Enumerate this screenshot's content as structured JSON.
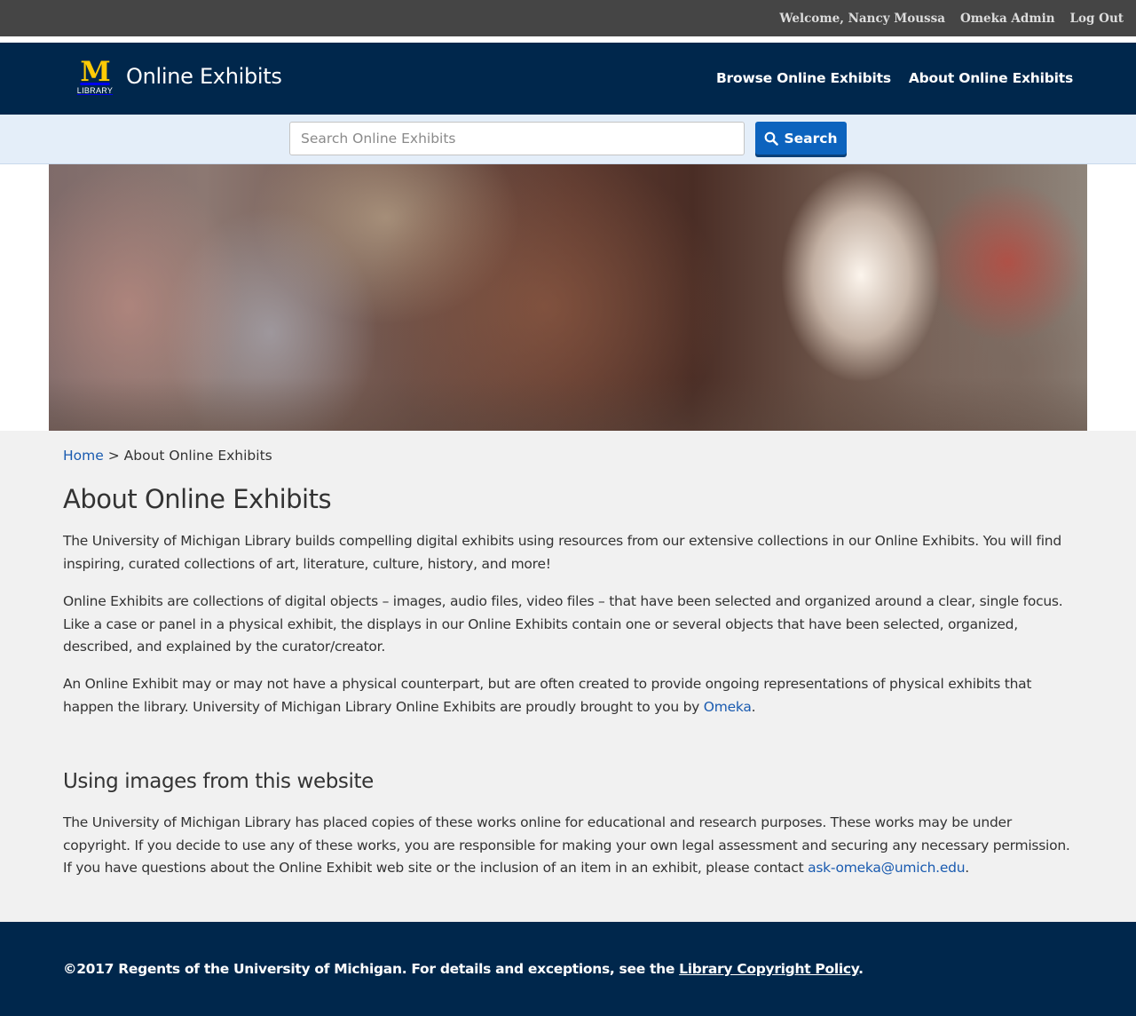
{
  "admin_bar": {
    "welcome": "Welcome, Nancy Moussa",
    "admin_link": "Omeka Admin",
    "logout_link": "Log Out"
  },
  "header": {
    "logo_letter": "M",
    "logo_subtext": "LIBRARY",
    "site_title": "Online Exhibits",
    "nav": [
      "Browse Online Exhibits",
      "About Online Exhibits"
    ]
  },
  "search": {
    "placeholder": "Search Online Exhibits",
    "button_label": "Search"
  },
  "breadcrumb": {
    "home": "Home",
    "separator": ">",
    "current": "About Online Exhibits"
  },
  "main": {
    "title": "About Online Exhibits",
    "paragraph_1": "The University of Michigan Library builds compelling digital exhibits using resources from our extensive collections in our Online Exhibits. You will find inspiring, curated collections of art, literature, culture, history, and more!",
    "paragraph_2": "Online Exhibits are collections of digital objects – images, audio files, video files – that have been selected and organized around a clear, single focus. Like a case or panel in a physical exhibit, the displays in our Online Exhibits contain one or several objects that have been selected, organized, described, and explained by the curator/creator.",
    "paragraph_3_text": "An Online Exhibit may or may not have a physical counterpart, but are often created to provide ongoing representations of physical exhibits that happen the library. University of Michigan Library Online Exhibits are proudly brought to you by",
    "paragraph_3_link": "Omeka",
    "paragraph_3_end": ".",
    "section_title": "Using images from this website",
    "section_text": "The University of Michigan Library has placed copies of these works online for educational and research purposes. These works may be under copyright. If you decide to use any of these works, you are responsible for making your own legal assessment and securing any necessary permission. If you have questions about the Online Exhibit web site or the inclusion of an item in an exhibit, please contact",
    "section_link": "ask-omeka@umich.edu",
    "section_end": "."
  },
  "footer": {
    "text": "©2017 Regents of the University of Michigan. For details and exceptions, see the",
    "link": "Library Copyright Policy",
    "end": "."
  },
  "colors": {
    "navy": "#00274c",
    "maize": "#ffcb05",
    "admin_bar": "#454545",
    "search_band": "#e4eef9",
    "button_blue": "#0c63be",
    "link_blue": "#1a5bb0",
    "page_bg": "#f1f1f1"
  },
  "icons": {
    "search_button_icon": "search-icon"
  }
}
